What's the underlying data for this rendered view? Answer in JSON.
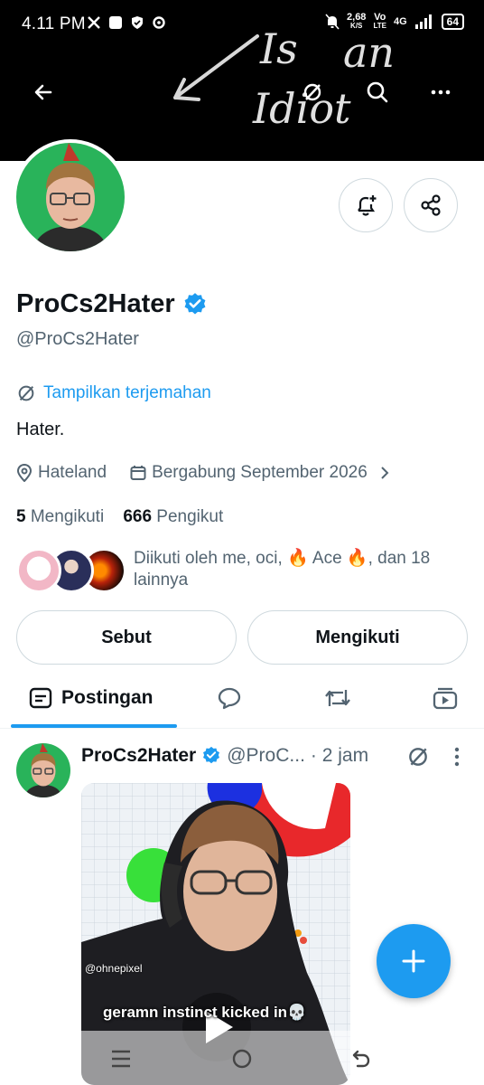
{
  "status_bar": {
    "time": "4.11 PM",
    "net_speed": "2,68",
    "net_unit": "K/S",
    "volte_top": "Vo",
    "volte_bottom": "LTE",
    "network": "4G",
    "battery": "64"
  },
  "banner": {
    "scribble_text_1": "Is",
    "scribble_text_2": "an",
    "scribble_text_3": "Idiot"
  },
  "profile": {
    "display_name": "ProCs2Hater",
    "handle": "@ProCs2Hater",
    "translate_label": "Tampilkan terjemahan",
    "bio": "Hater.",
    "location": "Hateland",
    "joined": "Bergabung September 2026",
    "following_count": "5",
    "following_label": "Mengikuti",
    "followers_count": "666",
    "followers_label": "Pengikut",
    "followed_by_text": "Diikuti oleh me, oci, 🔥 Ace 🔥, dan 18 lainnya"
  },
  "actions": {
    "mention_label": "Sebut",
    "following_button_label": "Mengikuti"
  },
  "tabs": {
    "posts_label": "Postingan"
  },
  "post": {
    "author_name": "ProCs2Hater",
    "author_handle": "@ProC...",
    "time": "· 2 jam",
    "media_watermark": "@ohnepixel",
    "media_caption": "geramn instinct kicked in💀"
  },
  "colors": {
    "accent": "#1d9bf0",
    "verified": "#1d9bf0",
    "avatar_bg": "#29b35a"
  }
}
